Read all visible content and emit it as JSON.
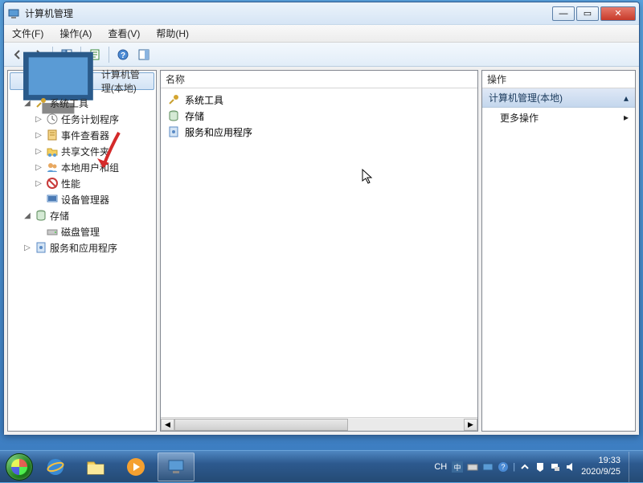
{
  "window": {
    "title": "计算机管理",
    "min": "—",
    "max": "▭",
    "close": "✕"
  },
  "menu": {
    "file": "文件(F)",
    "action": "操作(A)",
    "view": "查看(V)",
    "help": "帮助(H)"
  },
  "left": {
    "root": "计算机管理(本地)",
    "sys_tools": "系统工具",
    "task_scheduler": "任务计划程序",
    "event_viewer": "事件查看器",
    "shared_folders": "共享文件夹",
    "local_users": "本地用户和组",
    "performance": "性能",
    "device_manager": "设备管理器",
    "storage": "存储",
    "disk_mgmt": "磁盘管理",
    "services": "服务和应用程序"
  },
  "center": {
    "header": "名称",
    "items": {
      "sys_tools": "系统工具",
      "storage": "存储",
      "services": "服务和应用程序"
    }
  },
  "right": {
    "header": "操作",
    "title": "计算机管理(本地)",
    "more": "更多操作"
  },
  "taskbar": {
    "ime_lang": "CH",
    "time": "19:33",
    "date": "2020/9/25"
  }
}
